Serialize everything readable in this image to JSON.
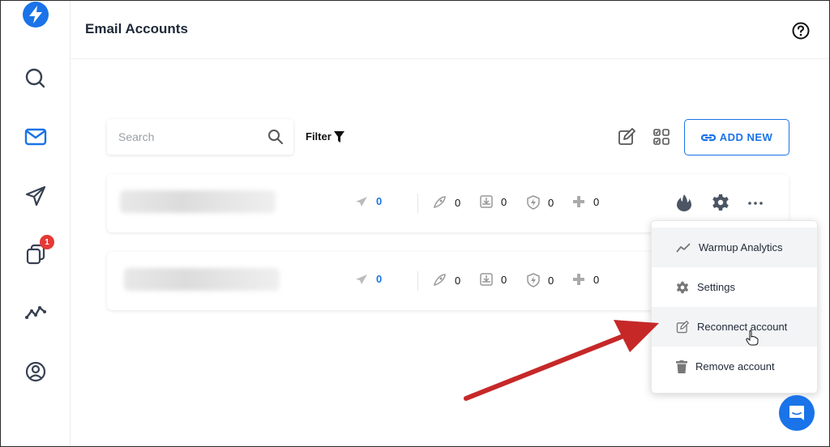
{
  "header": {
    "title": "Email Accounts"
  },
  "sidebar": {
    "items": [
      {
        "name": "search",
        "icon": "search-icon"
      },
      {
        "name": "email",
        "icon": "envelope-icon",
        "active": true
      },
      {
        "name": "campaigns",
        "icon": "paper-plane-icon"
      },
      {
        "name": "unibox",
        "icon": "copy-icon",
        "badge": "1"
      },
      {
        "name": "analytics",
        "icon": "trend-line-icon"
      },
      {
        "name": "profile",
        "icon": "user-circle-icon"
      }
    ]
  },
  "toolbar": {
    "search_placeholder": "Search",
    "filter_label": "Filter",
    "add_new_label": "ADD NEW"
  },
  "accounts": [
    {
      "sent": "0",
      "replies": "0",
      "inbox": "0",
      "health": "0",
      "other": "0"
    },
    {
      "sent": "0",
      "replies": "0",
      "inbox": "0",
      "health": "0",
      "other": "0"
    }
  ],
  "menu": {
    "items": [
      {
        "label": "Warmup Analytics",
        "icon": "trend-line-icon"
      },
      {
        "label": "Settings",
        "icon": "gear-icon"
      },
      {
        "label": "Reconnect account",
        "icon": "edit-icon"
      },
      {
        "label": "Remove account",
        "icon": "trash-icon"
      }
    ]
  },
  "colors": {
    "accent": "#1a73e8",
    "badge": "#e53935",
    "arrow": "#c62828"
  }
}
